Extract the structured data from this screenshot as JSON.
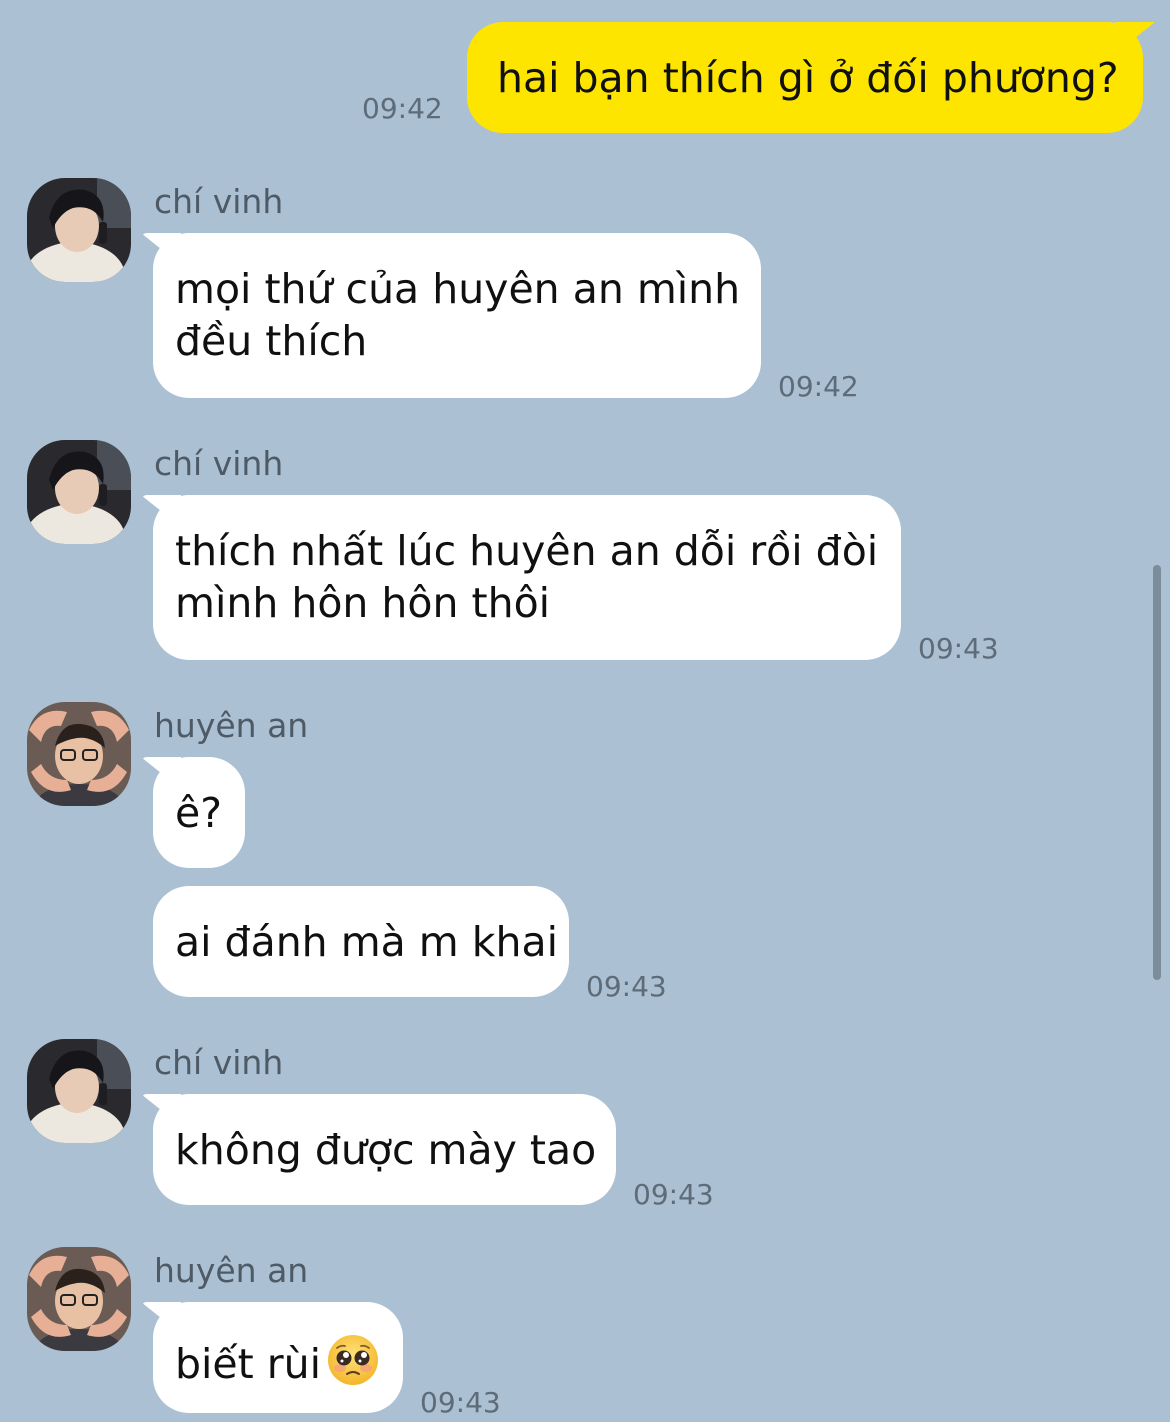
{
  "chat": {
    "messages": [
      {
        "type": "sent",
        "text": "hai bạn thích gì ở đối phương?",
        "time": "09:42"
      },
      {
        "type": "received",
        "sender": "chí vinh",
        "lines": [
          "mọi thứ của huyên an mình",
          "đều thích"
        ],
        "time": "09:42"
      },
      {
        "type": "received",
        "sender": "chí vinh",
        "lines": [
          "thích nhất lúc huyên an dỗi rồi đòi",
          "mình hôn hôn thôi"
        ],
        "time": "09:43"
      },
      {
        "type": "received",
        "sender": "huyên an",
        "lines": [
          "ê?"
        ]
      },
      {
        "type": "received",
        "sender": "huyên an",
        "lines": [
          "ai đánh mà m khai"
        ],
        "time": "09:43"
      },
      {
        "type": "received",
        "sender": "chí vinh",
        "lines": [
          "không được mày tao"
        ],
        "time": "09:43"
      },
      {
        "type": "received",
        "sender": "huyên an",
        "lines": [
          "biết rùi"
        ],
        "emoji": "pleading-face-emoji",
        "time": "09:43"
      }
    ]
  },
  "colors": {
    "background": "#abc1d3",
    "sent_bubble": "#fee500",
    "received_bubble": "#ffffff"
  }
}
